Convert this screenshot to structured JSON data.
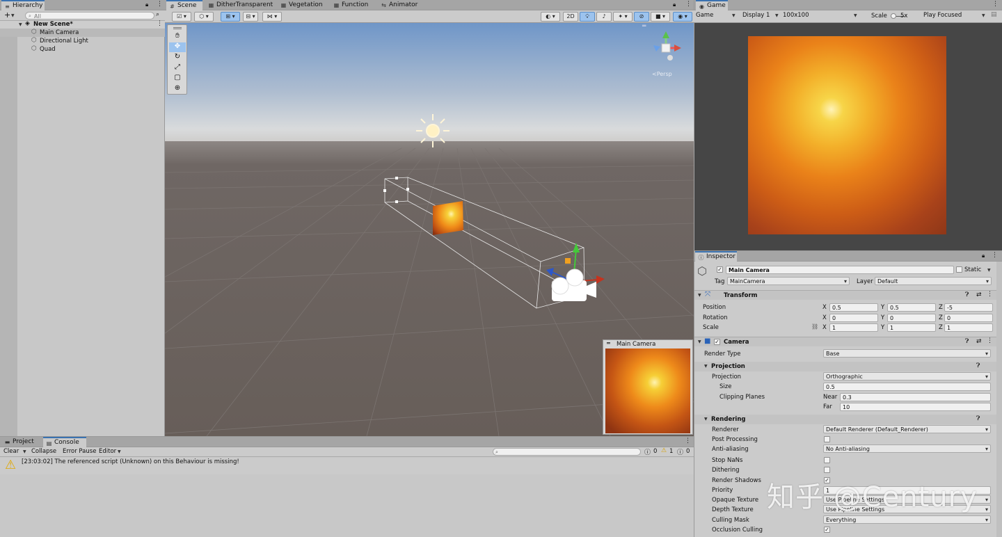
{
  "hierarchy": {
    "tab": "Hierarchy",
    "add_label": "+",
    "search_placeholder": "All",
    "scene": "New Scene*",
    "items": [
      "Main Camera",
      "Directional Light",
      "Quad"
    ]
  },
  "scene_tabs": [
    "Scene",
    "DitherTransparent",
    "Vegetation",
    "Function",
    "Animator"
  ],
  "scene_toolbar": {
    "mode_2d": "2D",
    "persp_label": "<Persp"
  },
  "game": {
    "tab": "Game",
    "display_mode": "Game",
    "display": "Display 1",
    "resolution": "100x100",
    "scale_label": "Scale",
    "scale_value": "5x",
    "play_mode": "Play Focused"
  },
  "camera_preview": {
    "title": "Main Camera"
  },
  "bottom_tabs": [
    "Project",
    "Console"
  ],
  "console": {
    "buttons": [
      "Clear",
      "Collapse",
      "Error Pause",
      "Editor"
    ],
    "counts": {
      "info": "0",
      "warn": "1",
      "error": "0"
    },
    "message": "[23:03:02] The referenced script (Unknown) on this Behaviour is missing!"
  },
  "inspector": {
    "tab": "Inspector",
    "object_name": "Main Camera",
    "static_label": "Static",
    "tag_label": "Tag",
    "tag_value": "MainCamera",
    "layer_label": "Layer",
    "layer_value": "Default",
    "transform": {
      "title": "Transform",
      "position": {
        "label": "Position",
        "x": "0.5",
        "y": "0.5",
        "z": "-5"
      },
      "rotation": {
        "label": "Rotation",
        "x": "0",
        "y": "0",
        "z": "0"
      },
      "scale": {
        "label": "Scale",
        "x": "1",
        "y": "1",
        "z": "1"
      }
    },
    "camera": {
      "title": "Camera",
      "render_type_label": "Render Type",
      "render_type": "Base",
      "projection_header": "Projection",
      "projection_label": "Projection",
      "projection": "Orthographic",
      "size_label": "Size",
      "size": "0.5",
      "clipping_label": "Clipping Planes",
      "near_label": "Near",
      "near": "0.3",
      "far_label": "Far",
      "far": "10",
      "rendering_header": "Rendering",
      "renderer_label": "Renderer",
      "renderer": "Default Renderer (Default_Renderer)",
      "post_processing_label": "Post Processing",
      "anti_aliasing_label": "Anti-aliasing",
      "anti_aliasing": "No Anti-aliasing",
      "stop_nans_label": "Stop NaNs",
      "dithering_label": "Dithering",
      "render_shadows_label": "Render Shadows",
      "priority_label": "Priority",
      "priority": "1",
      "opaque_texture_label": "Opaque Texture",
      "opaque_texture": "Use Pipeline Settings",
      "depth_texture_label": "Depth Texture",
      "depth_texture": "Use Pipeline Settings",
      "culling_mask_label": "Culling Mask",
      "culling_mask": "Everything",
      "occlusion_culling_label": "Occlusion Culling"
    }
  },
  "watermark": "知乎 @Century",
  "colors": {
    "accent": "#3a72b0",
    "panel": "#cbcbcb",
    "sky_top": "#6f96c8",
    "ground": "#6a625e"
  }
}
